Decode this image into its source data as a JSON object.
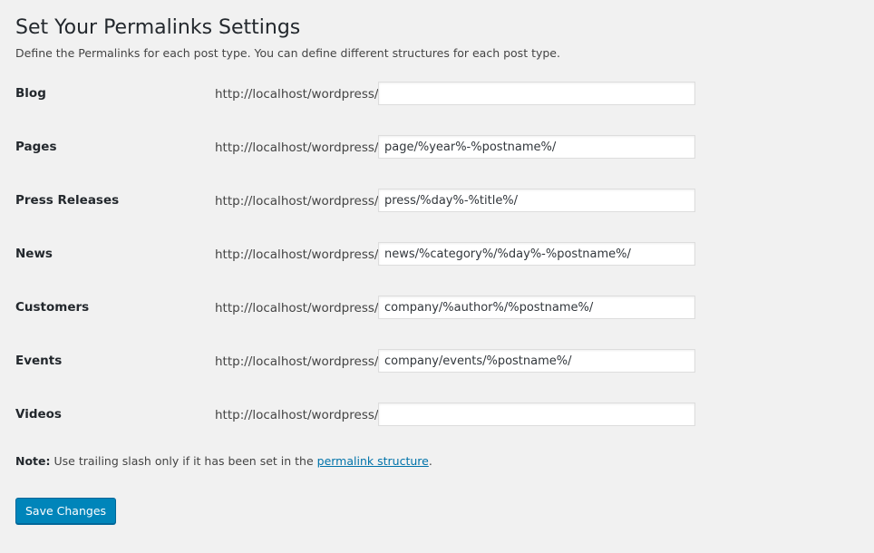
{
  "page": {
    "title": "Set Your Permalinks Settings",
    "description": "Define the Permalinks for each post type. You can define different structures for each post type."
  },
  "base_url": "http://localhost/wordpress/",
  "rows": [
    {
      "label": "Blog",
      "value": ""
    },
    {
      "label": "Pages",
      "value": "page/%year%-%postname%/"
    },
    {
      "label": "Press Releases",
      "value": "press/%day%-%title%/"
    },
    {
      "label": "News",
      "value": "news/%category%/%day%-%postname%/"
    },
    {
      "label": "Customers",
      "value": "company/%author%/%postname%/"
    },
    {
      "label": "Events",
      "value": "company/events/%postname%/"
    },
    {
      "label": "Videos",
      "value": ""
    }
  ],
  "note": {
    "strong": "Note:",
    "text": " Use trailing slash only if it has been set in the ",
    "link": "permalink structure",
    "end": "."
  },
  "save_label": "Save Changes",
  "colors": {
    "background": "#f1f1f1",
    "primary_button": "#0085ba",
    "link": "#0073aa"
  }
}
